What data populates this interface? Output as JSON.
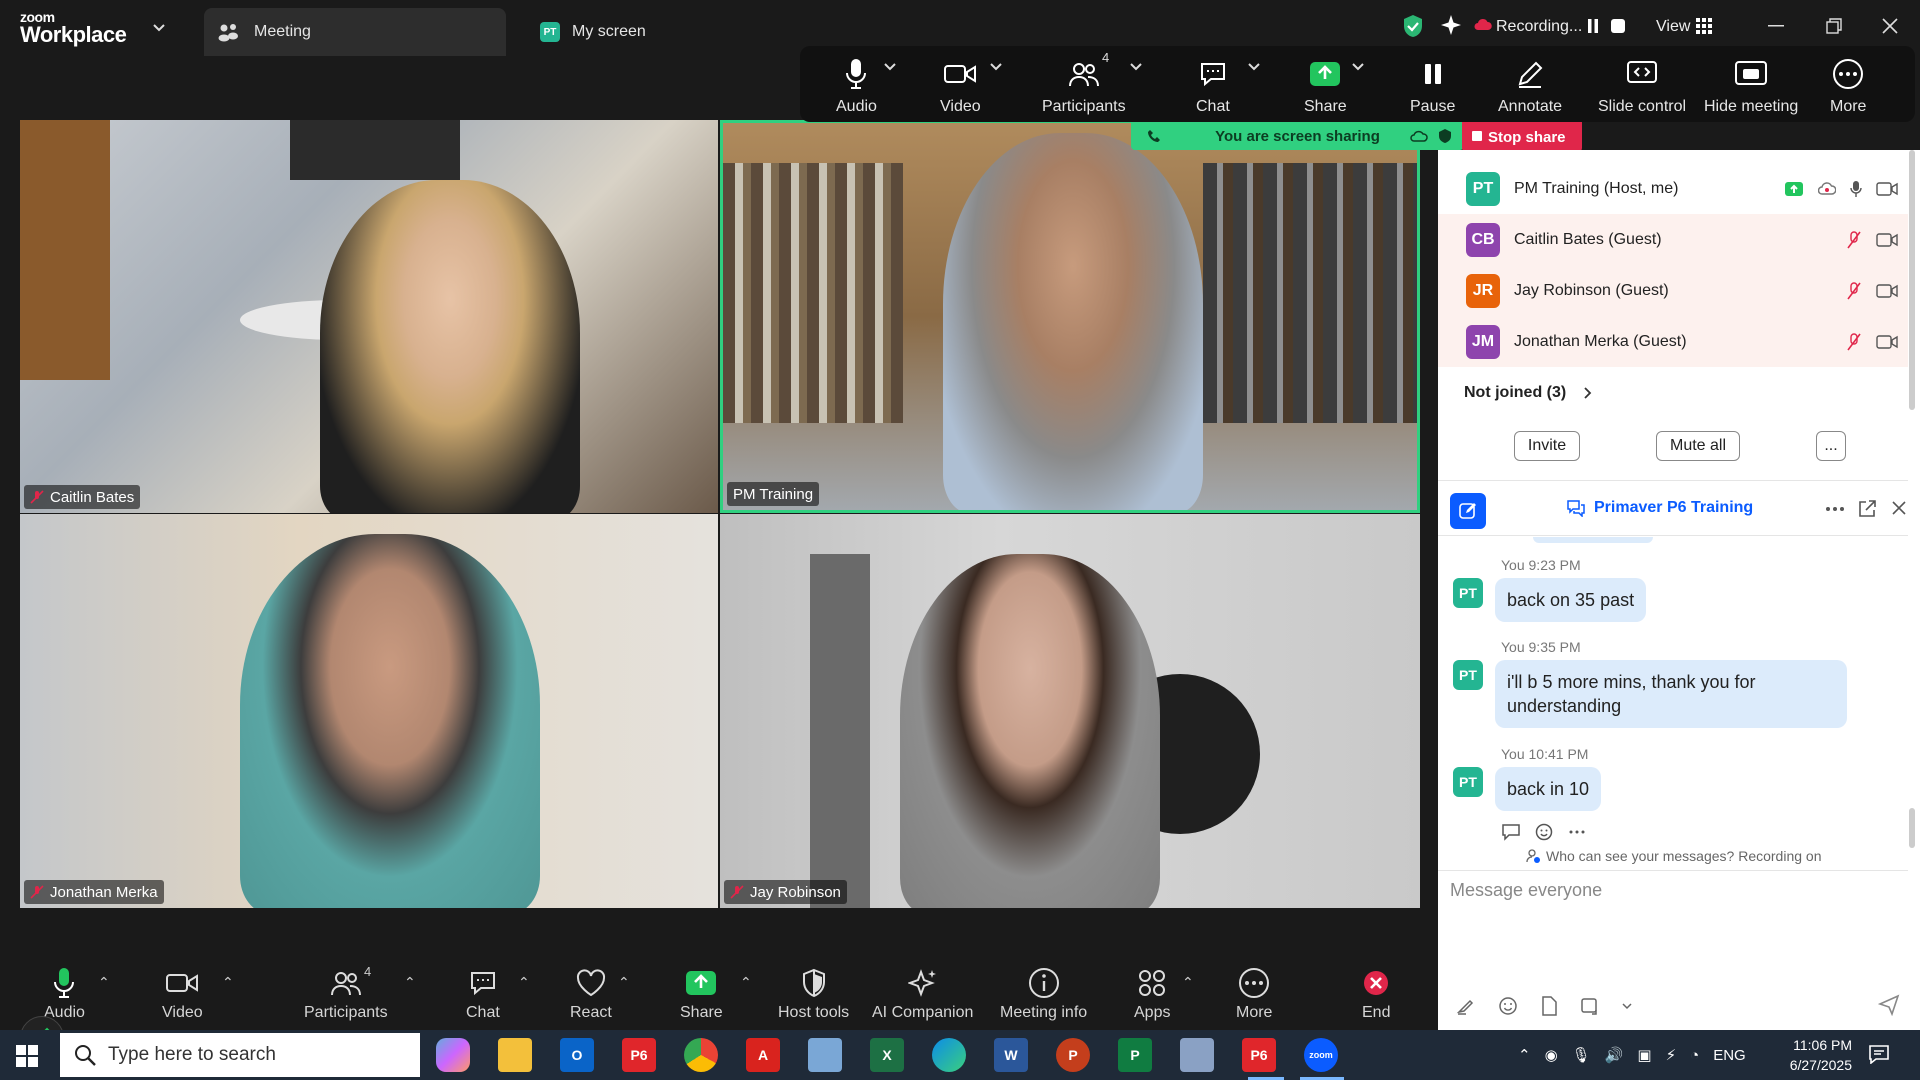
{
  "titlebar": {
    "brand_top": "zoom",
    "brand_bottom": "Workplace",
    "tab_meeting": "Meeting",
    "tab_myscreen": "My screen",
    "tab_myscreen_avatar": "PT",
    "recording": "Recording...",
    "view": "View"
  },
  "share_toolbar": {
    "audio": "Audio",
    "video": "Video",
    "participants": "Participants",
    "participants_count": "4",
    "chat": "Chat",
    "share": "Share",
    "pause": "Pause",
    "annotate": "Annotate",
    "slide_control": "Slide control",
    "hide_meeting": "Hide meeting",
    "more": "More"
  },
  "banner": {
    "text": "You are screen sharing",
    "stop": "Stop share"
  },
  "tiles": [
    {
      "name": "Caitlin Bates"
    },
    {
      "name": "PM Training"
    },
    {
      "name": "Jonathan Merka"
    },
    {
      "name": "Jay Robinson"
    }
  ],
  "participants": {
    "rows": [
      {
        "initials": "PT",
        "name": "PM Training (Host, me)",
        "color": "#24b592"
      },
      {
        "initials": "CB",
        "name": "Caitlin Bates (Guest)",
        "color": "#8e44ad"
      },
      {
        "initials": "JR",
        "name": "Jay Robinson (Guest)",
        "color": "#e8630a"
      },
      {
        "initials": "JM",
        "name": "Jonathan Merka (Guest)",
        "color": "#8e44ad"
      }
    ],
    "not_joined": "Not joined (3)",
    "invite": "Invite",
    "mute_all": "Mute all",
    "more": "..."
  },
  "chat": {
    "title": "Primaver P6 Training",
    "messages": [
      {
        "meta": "You 9:23 PM",
        "text": "back on 35 past",
        "avatar": "PT"
      },
      {
        "meta": "You 9:35 PM",
        "text": "i'll b 5 more mins,  thank you for understanding",
        "avatar": "PT"
      },
      {
        "meta": "You 10:41 PM",
        "text": "back in 10",
        "avatar": "PT"
      }
    ],
    "who_can_see": "Who can see your messages? Recording on",
    "placeholder": "Message everyone"
  },
  "bottom_toolbar": {
    "audio": "Audio",
    "video": "Video",
    "participants": "Participants",
    "participants_count": "4",
    "chat": "Chat",
    "react": "React",
    "share": "Share",
    "host_tools": "Host tools",
    "ai_companion": "AI Companion",
    "meeting_info": "Meeting info",
    "apps": "Apps",
    "more": "More",
    "end": "End"
  },
  "taskbar": {
    "search_placeholder": "Type here to search",
    "lang": "ENG",
    "time": "11:06 PM",
    "date": "6/27/2025",
    "p6_label": "P6"
  },
  "colors": {
    "accent": "#0b5cff",
    "share_green": "#30d080",
    "stop_red": "#e0264a",
    "mute_red": "#e0264a"
  }
}
